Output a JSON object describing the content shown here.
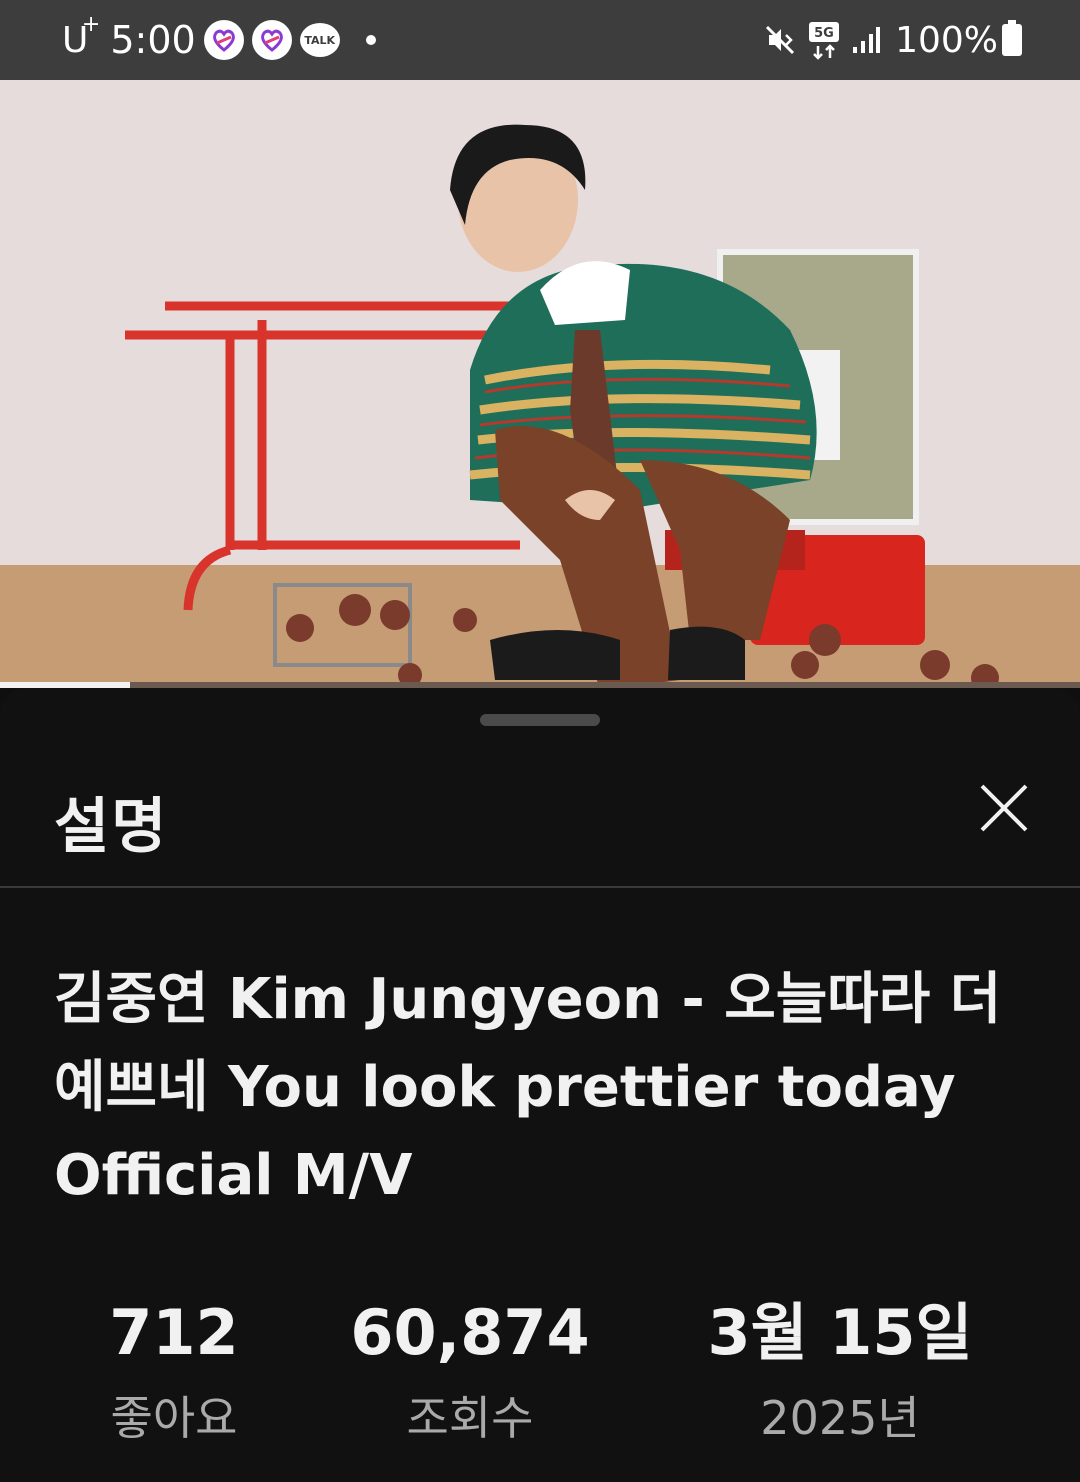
{
  "status_bar": {
    "carrier": "U",
    "carrier_sup": "+",
    "time": "5:00",
    "talk_label": "TALK",
    "network": "5G",
    "battery": "100%"
  },
  "video": {
    "progress_fraction": 0.12
  },
  "description_sheet": {
    "title": "설명",
    "video_title": "김중연 Kim Jungyeon - 오늘따라 더 예쁘네 You look prettier today Official M/V",
    "stats": {
      "likes_value": "712",
      "likes_label": "좋아요",
      "views_value": "60,874",
      "views_label": "조회수",
      "date_value": "3월 15일",
      "date_label": "2025년"
    }
  },
  "colors": {
    "sheet_background": "#111111",
    "status_bar_background": "#3d3d3d",
    "primary_text": "#f1f1f1",
    "secondary_text": "#aaaaaa"
  },
  "icons": [
    "heart-app-icon",
    "talk-icon",
    "mute-icon",
    "network-5g-icon",
    "signal-icon",
    "battery-icon",
    "close-icon"
  ]
}
